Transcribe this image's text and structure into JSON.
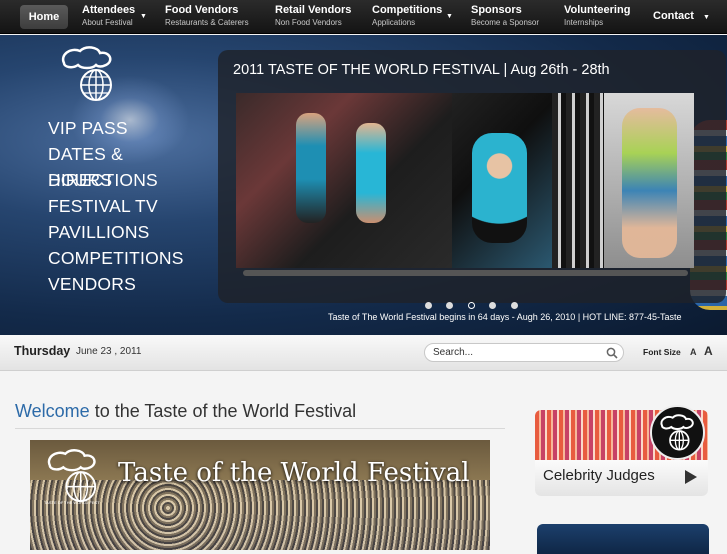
{
  "nav": {
    "home": "Home",
    "items": [
      {
        "title": "Attendees",
        "sub": "About Festival"
      },
      {
        "title": "Food Vendors",
        "sub": "Restaurants & Caterers"
      },
      {
        "title": "Retail Vendors",
        "sub": "Non Food Vendors"
      },
      {
        "title": "Competitions",
        "sub": "Applications"
      },
      {
        "title": "Sponsors",
        "sub": "Become a Sponsor"
      },
      {
        "title": "Volunteering",
        "sub": "Internships"
      }
    ],
    "contact": "Contact"
  },
  "side_menu": {
    "vip": "VIP PASS",
    "dates": "DATES &",
    "directions": "DIRECTIONS",
    "hours": "HOURS",
    "tv": "FESTIVAL TV",
    "pavillions": "PAVILLIONS",
    "competitions": "COMPETITIONS",
    "vendors": "VENDORS"
  },
  "slider": {
    "title": "2011 TASTE OF THE WORLD FESTIVAL | Aug 26th - 28th",
    "dot_count": 5,
    "active_dot": 3
  },
  "ticker": "Taste of The World Festival begins in 64 days - Augh 26, 2010 | HOT LINE: 877-45-Taste",
  "datebar": {
    "day": "Thursday",
    "date": "June 23 , 2011",
    "search_value": "Search...",
    "font_size_label": "Font Size",
    "font_small": "A",
    "font_big": "A"
  },
  "welcome": {
    "highlight": "Welcome",
    "rest": " to the Taste of the World Festival"
  },
  "banner": {
    "title": "Taste of the World Festival",
    "logo_caption": "TASTE OF THE WORLD FEST"
  },
  "celebrity": {
    "label": "Celebrity Judges"
  },
  "colors": {
    "accent_blue": "#2c6aa8",
    "nav_bg": "#1f1f1f",
    "hero_bg": "#1b355a"
  }
}
